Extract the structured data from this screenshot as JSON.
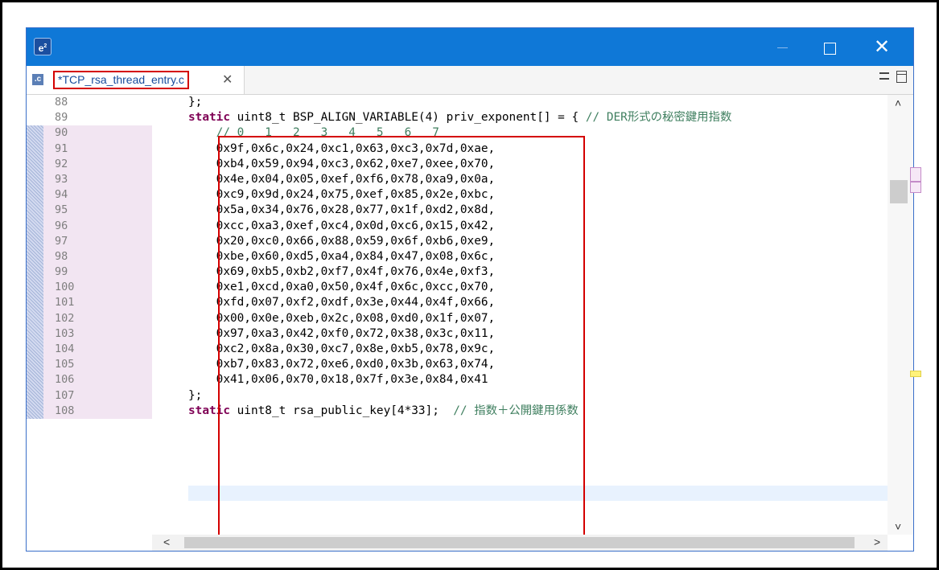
{
  "window": {
    "app_logo": "e²",
    "maximize_label": "",
    "close_label": "✕"
  },
  "tab": {
    "icon": ".c",
    "title": "*TCP_rsa_thread_entry.c",
    "close": "✕"
  },
  "editor": {
    "lines": [
      {
        "n": "88",
        "text": "};"
      },
      {
        "n": "89",
        "kw": "static",
        "text": " uint8_t BSP_ALIGN_VARIABLE(4) priv_exponent[] = { ",
        "comment": "// DER形式の秘密鍵用指数"
      },
      {
        "n": "90",
        "text": "    ",
        "comment": "// 0   1   2   3   4   5   6   7"
      },
      {
        "n": "91",
        "text": "    0x9f,0x6c,0x24,0xc1,0x63,0xc3,0x7d,0xae,"
      },
      {
        "n": "92",
        "text": "    0xb4,0x59,0x94,0xc3,0x62,0xe7,0xee,0x70,"
      },
      {
        "n": "93",
        "text": "    0x4e,0x04,0x05,0xef,0xf6,0x78,0xa9,0x0a,"
      },
      {
        "n": "94",
        "text": "    0xc9,0x9d,0x24,0x75,0xef,0x85,0x2e,0xbc,"
      },
      {
        "n": "95",
        "text": "    0x5a,0x34,0x76,0x28,0x77,0x1f,0xd2,0x8d,"
      },
      {
        "n": "96",
        "text": "    0xcc,0xa3,0xef,0xc4,0x0d,0xc6,0x15,0x42,"
      },
      {
        "n": "97",
        "text": "    0x20,0xc0,0x66,0x88,0x59,0x6f,0xb6,0xe9,"
      },
      {
        "n": "98",
        "text": "    0xbe,0x60,0xd5,0xa4,0x84,0x47,0x08,0x6c,"
      },
      {
        "n": "99",
        "text": "    0x69,0xb5,0xb2,0xf7,0x4f,0x76,0x4e,0xf3,"
      },
      {
        "n": "100",
        "text": "    0xe1,0xcd,0xa0,0x50,0x4f,0x6c,0xcc,0x70,"
      },
      {
        "n": "101",
        "text": "    0xfd,0x07,0xf2,0xdf,0x3e,0x44,0x4f,0x66,"
      },
      {
        "n": "102",
        "text": "    0x00,0x0e,0xeb,0x2c,0x08,0xd0,0x1f,0x07,"
      },
      {
        "n": "103",
        "text": "    0x97,0xa3,0x42,0xf0,0x72,0x38,0x3c,0x11,"
      },
      {
        "n": "104",
        "text": "    0xc2,0x8a,0x30,0xc7,0x8e,0xb5,0x78,0x9c,"
      },
      {
        "n": "105",
        "text": "    0xb7,0x83,0x72,0xe6,0xd0,0x3b,0x63,0x74,"
      },
      {
        "n": "106",
        "text": "    0x41,0x06,0x70,0x18,0x7f,0x3e,0x84,0x41"
      },
      {
        "n": "107",
        "text": "};"
      },
      {
        "n": "108",
        "kw": "static",
        "text": " uint8_t rsa_public_key[4*33];  ",
        "comment": "// 指数＋公開鍵用係数"
      }
    ]
  },
  "scroll": {
    "up": "˄",
    "down": "˅",
    "left": "<",
    "right": ">"
  },
  "colors": {
    "titlebar": "#0f78d7",
    "keyword": "#7f0055",
    "comment": "#3f7f5f",
    "highlight_box": "#d40000"
  }
}
